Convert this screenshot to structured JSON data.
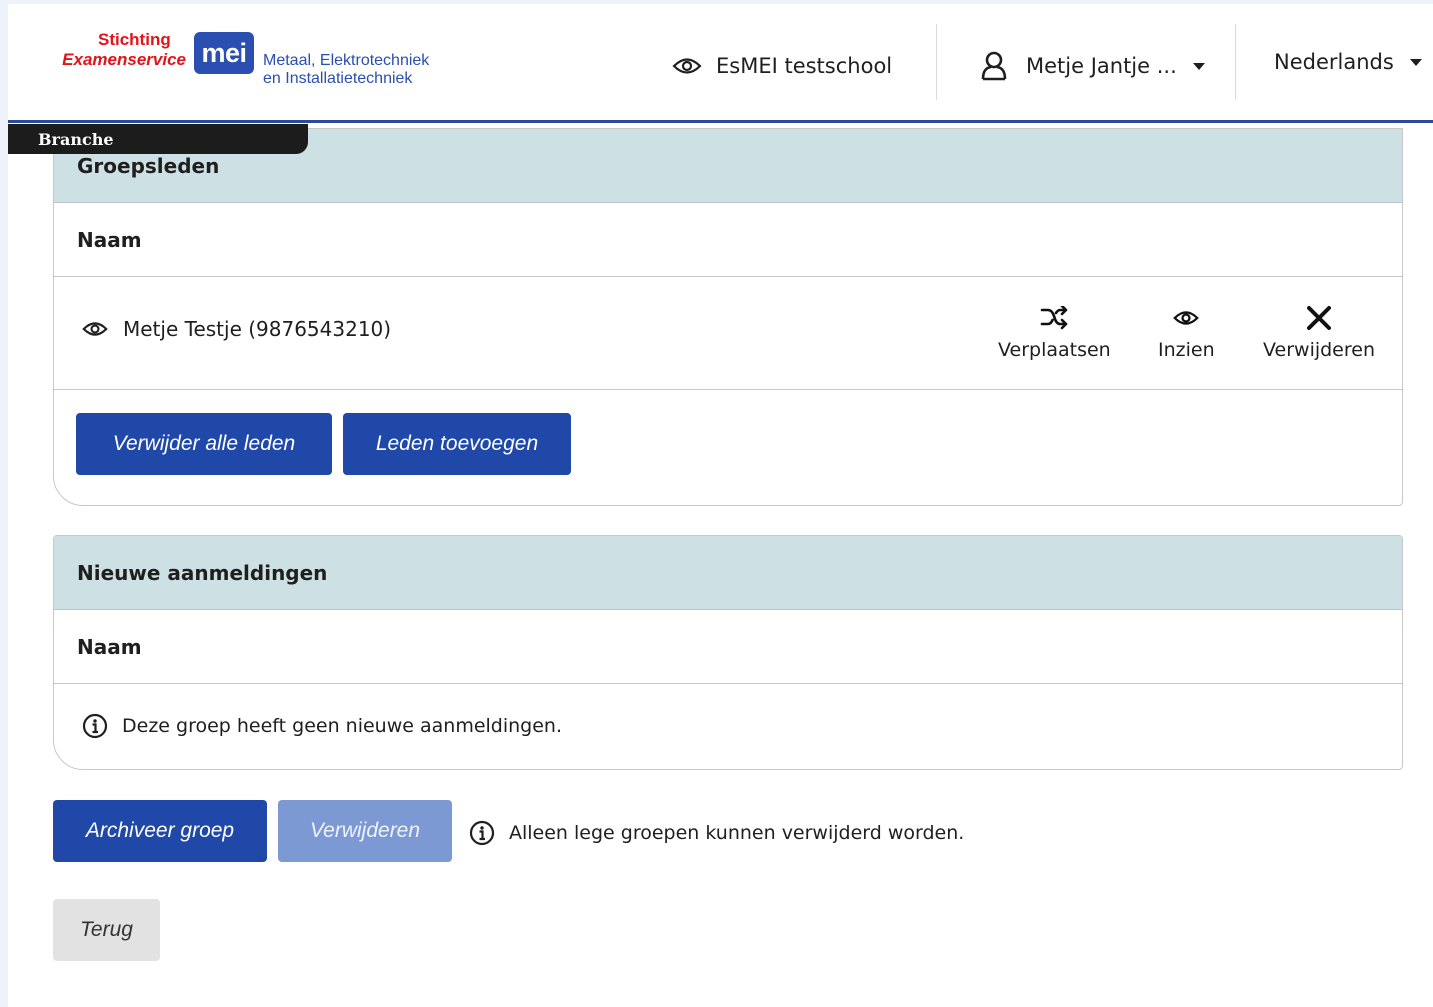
{
  "header": {
    "logo": {
      "stichting": "Stichting",
      "examenservice": "Examenservice",
      "mei": "mei",
      "sub_line1": "Metaal, Elektrotechniek",
      "sub_line2": "en Installatietechniek"
    },
    "school": {
      "label": "EsMEI testschool",
      "icon": "eye-icon"
    },
    "user": {
      "label": "Metje Jantje ...",
      "icon": "user-icon"
    },
    "language": {
      "label": "Nederlands"
    },
    "accent_color": "#2a4b9b"
  },
  "branche_tab": {
    "label": "Branche"
  },
  "groepsleden": {
    "title": "Groepsleden",
    "column_header": "Naam",
    "members": [
      {
        "name": "Metje Testje (9876543210)",
        "actions": [
          {
            "label": "Verplaatsen",
            "icon": "shuffle-icon"
          },
          {
            "label": "Inzien",
            "icon": "eye-icon"
          },
          {
            "label": "Verwijderen",
            "icon": "close-icon"
          }
        ]
      }
    ],
    "buttons": {
      "remove_all": "Verwijder alle leden",
      "add_members": "Leden toevoegen"
    }
  },
  "nieuwe_aanmeldingen": {
    "title": "Nieuwe aanmeldingen",
    "column_header": "Naam",
    "empty_message": "Deze groep heeft geen nieuwe aanmeldingen."
  },
  "footer_actions": {
    "archive": "Archiveer groep",
    "delete": "Verwijderen",
    "delete_info": "Alleen lege groepen kunnen verwijderd worden.",
    "back": "Terug"
  },
  "colors": {
    "primary_button": "#1f48a8",
    "disabled_button": "#7d99d3",
    "card_header": "#cde0e4"
  }
}
